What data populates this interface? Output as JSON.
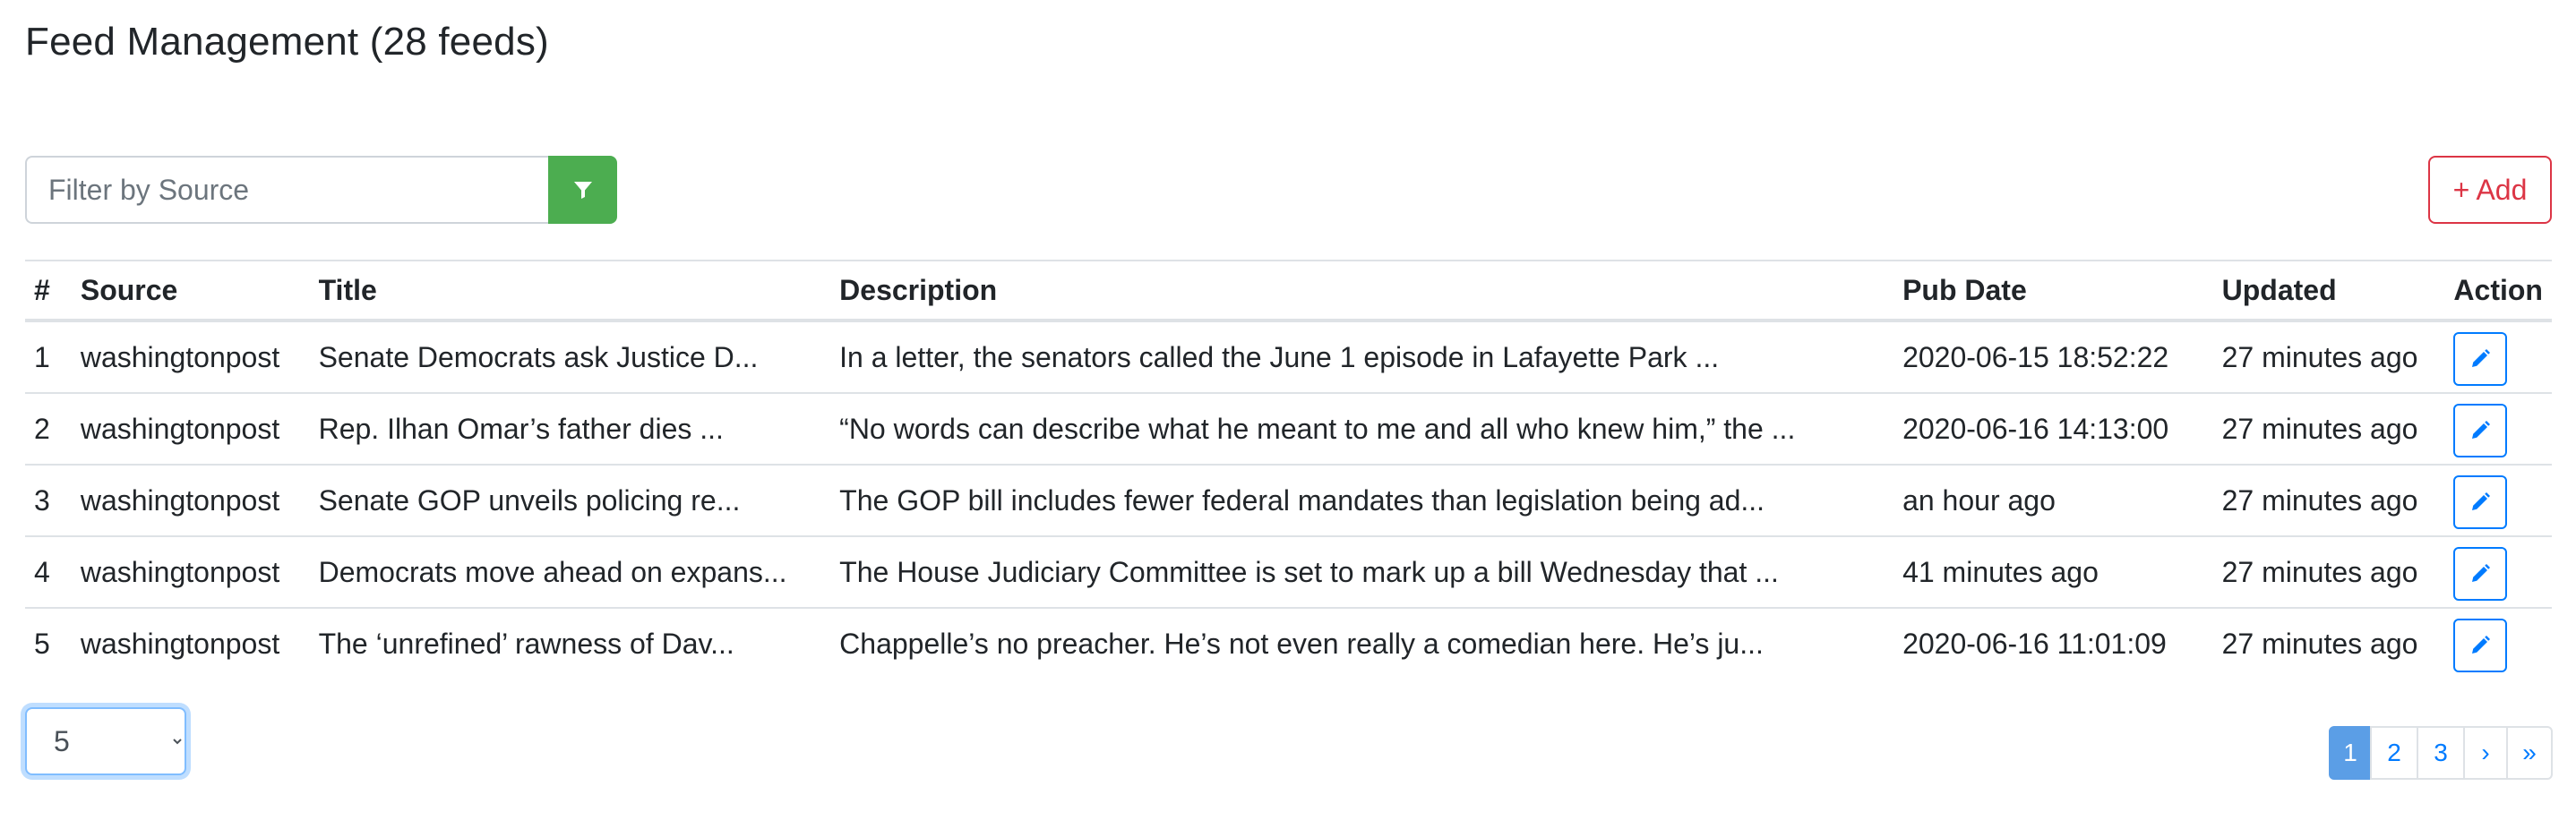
{
  "page": {
    "title": "Feed Management (28 feeds)"
  },
  "filter": {
    "placeholder": "Filter by Source",
    "value": "",
    "button_icon": "filter-icon"
  },
  "add_button_label": "+ Add",
  "table": {
    "columns": [
      "#",
      "Source",
      "Title",
      "Description",
      "Pub Date",
      "Updated",
      "Action"
    ],
    "rows": [
      {
        "num": "1",
        "source": "washingtonpost",
        "title": "Senate Democrats ask Justice D...",
        "description": "In a letter, the senators called the June 1 episode in Lafayette Park ...",
        "pub_date": "2020-06-15 18:52:22",
        "updated": "27 minutes ago"
      },
      {
        "num": "2",
        "source": "washingtonpost",
        "title": "Rep. Ilhan Omar’s father dies ...",
        "description": "“No words can describe what he meant to me and all who knew him,” the ...",
        "pub_date": "2020-06-16 14:13:00",
        "updated": "27 minutes ago"
      },
      {
        "num": "3",
        "source": "washingtonpost",
        "title": "Senate GOP unveils policing re...",
        "description": "The GOP bill includes fewer federal mandates than legislation being ad...",
        "pub_date": "an hour ago",
        "updated": "27 minutes ago"
      },
      {
        "num": "4",
        "source": "washingtonpost",
        "title": "Democrats move ahead on expans...",
        "description": "The House Judiciary Committee is set to mark up a bill Wednesday that ...",
        "pub_date": "41 minutes ago",
        "updated": "27 minutes ago"
      },
      {
        "num": "5",
        "source": "washingtonpost",
        "title": "The ‘unrefined’ rawness of Dav...",
        "description": "Chappelle’s no preacher. He’s not even really a comedian here. He’s ju...",
        "pub_date": "2020-06-16 11:01:09",
        "updated": "27 minutes ago"
      }
    ],
    "action_icon": "pencil-icon"
  },
  "page_size": {
    "selected": "5",
    "options": [
      "5"
    ]
  },
  "pagination": {
    "items": [
      "1",
      "2",
      "3",
      "›",
      "»"
    ],
    "active": "1"
  },
  "colors": {
    "filter_button": "#4cad50",
    "add_button": "#dc3545",
    "edit_button": "#007bff",
    "pagination_active": "#5b9ee6",
    "link": "#007bff"
  }
}
